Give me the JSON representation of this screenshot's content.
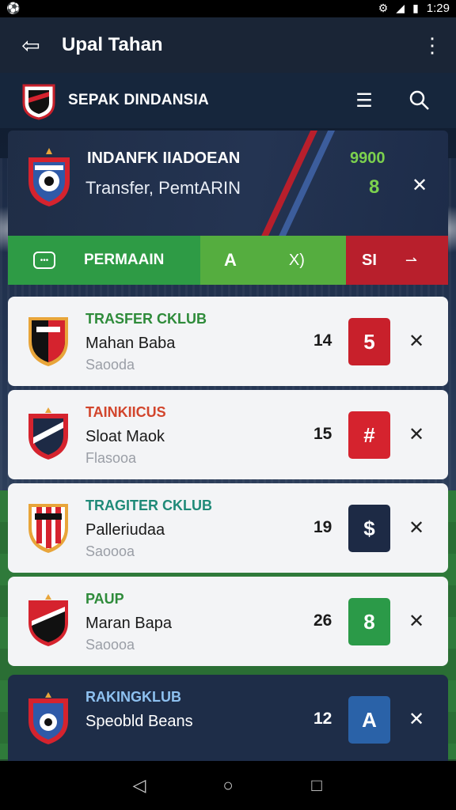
{
  "statusbar": {
    "time": "1:29"
  },
  "appbar": {
    "title": "Upal Tahan"
  },
  "subbar": {
    "brand": "SEPAK DINDANSIA"
  },
  "featured": {
    "name": "INDANFK IIADOEAN",
    "subtitle": "Transfer, PemtARIN",
    "score_top": "9900",
    "score_bottom": "8"
  },
  "actionbar": {
    "label": "PERMAAIN",
    "mid_left": "A",
    "mid_right": "X)",
    "right_label": "SI"
  },
  "items": [
    {
      "club": "TRASFER CKLUB",
      "club_color": "#2e8b3a",
      "player": "Mahan Baba",
      "meta": "Saooda",
      "num": "14",
      "badge": "5",
      "badge_color": "#c8202b",
      "dark": false
    },
    {
      "club": "TAINKIICUS",
      "club_color": "#d2452c",
      "player": "Sloat Maok",
      "meta": "Flasooa",
      "num": "15",
      "badge": "#",
      "badge_color": "#d5232e",
      "dark": false
    },
    {
      "club": "TRAGITER CKLUB",
      "club_color": "#1f8a78",
      "player": "Palleriudaa",
      "meta": "Saoooa",
      "num": "19",
      "badge": "$",
      "badge_color": "#1d2a45",
      "dark": false
    },
    {
      "club": "PAUP",
      "club_color": "#2e8b3a",
      "player": "Maran Bapa",
      "meta": "Saoooa",
      "num": "26",
      "badge": "8",
      "badge_color": "#2b9a48",
      "dark": false
    },
    {
      "club": "RAKINGKLUB",
      "club_color": "#8ec1f0",
      "player": "Speobld Beans",
      "meta": "",
      "num": "12",
      "badge": "A",
      "badge_color": "#2a62a8",
      "dark": true
    }
  ]
}
